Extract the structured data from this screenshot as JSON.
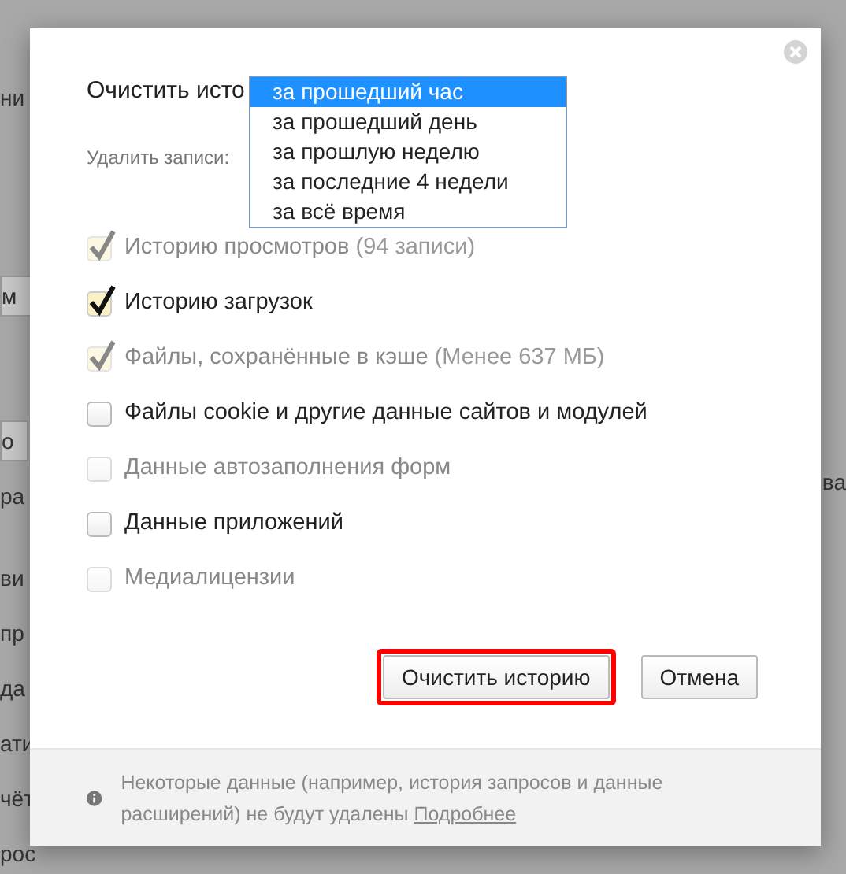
{
  "background_page": [
    {
      "kind": "text",
      "text": "ни"
    },
    {
      "kind": "button",
      "text": "м"
    },
    {
      "kind": "button",
      "text": "о"
    },
    {
      "kind": "text",
      "text": "ра"
    },
    {
      "kind": "text",
      "text": "ви"
    },
    {
      "kind": "text",
      "text": "пр"
    },
    {
      "kind": "text",
      "text": "да"
    },
    {
      "kind": "text",
      "text": "ати"
    },
    {
      "kind": "text",
      "text": "чёт"
    },
    {
      "kind": "text",
      "text": "рос"
    }
  ],
  "background_right": "ва",
  "dialog": {
    "title": "Очистить исто",
    "period_label": "Удалить записи:",
    "period_options": [
      {
        "label": "за прошедший час",
        "selected": true
      },
      {
        "label": "за прошедший день",
        "selected": false
      },
      {
        "label": "за прошлую неделю",
        "selected": false
      },
      {
        "label": "за последние 4 недели",
        "selected": false
      },
      {
        "label": "за всё время",
        "selected": false
      }
    ],
    "items": [
      {
        "label": "Историю просмотров",
        "detail": "(94 записи)",
        "checked": true,
        "disabled": true
      },
      {
        "label": "Историю загрузок",
        "checked": true,
        "disabled": false
      },
      {
        "label": "Файлы, сохранённые в кэше",
        "detail": "(Менее 637 МБ)",
        "checked": true,
        "disabled": true
      },
      {
        "label": "Файлы cookie и другие данные сайтов и модулей",
        "checked": false,
        "disabled": false
      },
      {
        "label": "Данные автозаполнения форм",
        "checked": false,
        "disabled": true
      },
      {
        "label": "Данные приложений",
        "checked": false,
        "disabled": false
      },
      {
        "label": "Медиалицензии",
        "checked": false,
        "disabled": true
      }
    ],
    "buttons": [
      {
        "label": "Очистить историю",
        "highlighted": true
      },
      {
        "label": "Отмена",
        "highlighted": false
      }
    ],
    "footer": {
      "text": "Некоторые данные (например, история запросов и данные расширений) не будут удалены",
      "link": "Подробнее"
    }
  }
}
